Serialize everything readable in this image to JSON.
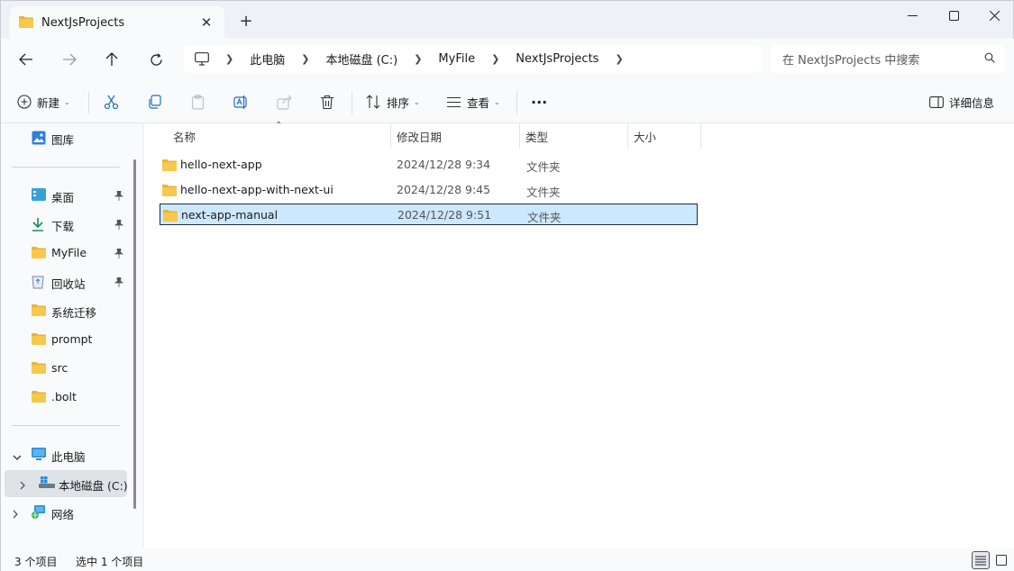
{
  "window": {
    "tab_title": "NextJsProjects",
    "new_tab_symbol": "+"
  },
  "address": {
    "crumbs": [
      "此电脑",
      "本地磁盘 (C:)",
      "MyFile",
      "NextJsProjects"
    ],
    "search_placeholder": "在 NextJsProjects 中搜索"
  },
  "toolbar": {
    "new_label": "新建",
    "sort_label": "排序",
    "view_label": "查看",
    "more_label": "···",
    "details_label": "详细信息"
  },
  "sidebar": {
    "gallery": "图库",
    "quick_access": [
      {
        "label": "桌面",
        "icon": "desktop-icon",
        "pinned": true
      },
      {
        "label": "下载",
        "icon": "download-icon",
        "pinned": true
      },
      {
        "label": "MyFile",
        "icon": "folder-icon",
        "pinned": true
      },
      {
        "label": "回收站",
        "icon": "recycle-bin-icon",
        "pinned": true
      },
      {
        "label": "系统迁移",
        "icon": "folder-icon",
        "pinned": false
      },
      {
        "label": "prompt",
        "icon": "folder-icon",
        "pinned": false
      },
      {
        "label": "src",
        "icon": "folder-icon",
        "pinned": false
      },
      {
        "label": ".bolt",
        "icon": "folder-icon",
        "pinned": false
      }
    ],
    "this_pc": "此电脑",
    "local_disk": "本地磁盘 (C:)",
    "network": "网络"
  },
  "columns": {
    "name": "名称",
    "date": "修改日期",
    "type": "类型",
    "size": "大小"
  },
  "files": [
    {
      "name": "hello-next-app",
      "date": "2024/12/28 9:34",
      "type": "文件夹",
      "selected": false
    },
    {
      "name": "hello-next-app-with-next-ui",
      "date": "2024/12/28 9:45",
      "type": "文件夹",
      "selected": false
    },
    {
      "name": "next-app-manual",
      "date": "2024/12/28 9:51",
      "type": "文件夹",
      "selected": true
    }
  ],
  "status": {
    "item_count": "3 个项目",
    "selected_count": "选中 1 个项目"
  },
  "colors": {
    "folder": "#f4c542",
    "selection": "#cce8ff",
    "accent": "#0067c0"
  }
}
